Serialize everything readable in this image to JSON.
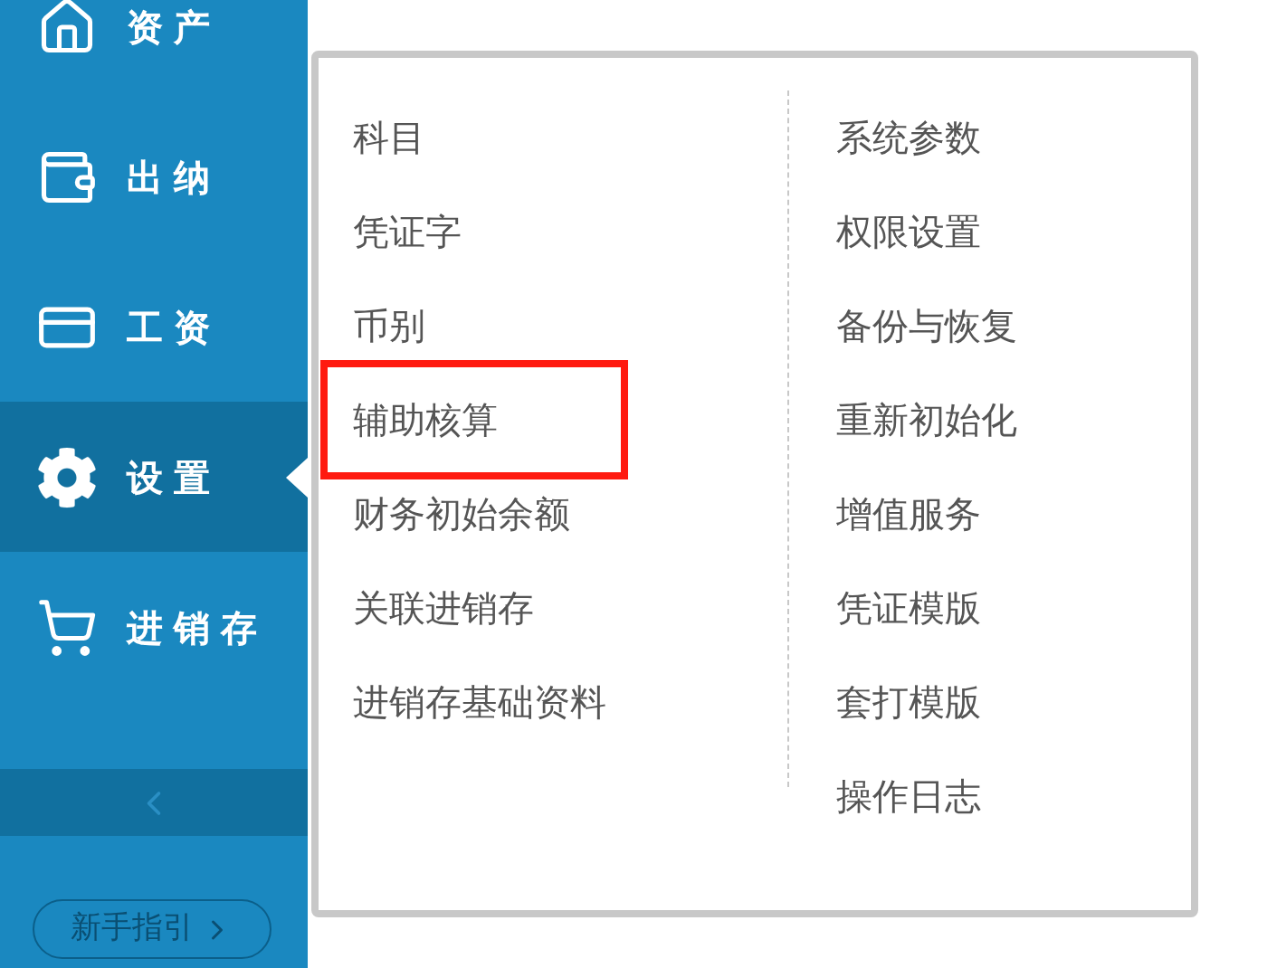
{
  "sidebar": {
    "items": [
      {
        "label": "资产",
        "selected": false
      },
      {
        "label": "出纳",
        "selected": false
      },
      {
        "label": "工资",
        "selected": false
      },
      {
        "label": "设置",
        "selected": true
      },
      {
        "label": "进销存",
        "selected": false
      }
    ],
    "guide_button": "新手指引"
  },
  "settings_menu": {
    "columns": [
      [
        {
          "label": "科目",
          "highlighted": false
        },
        {
          "label": "凭证字",
          "highlighted": false
        },
        {
          "label": "币别",
          "highlighted": false
        },
        {
          "label": "辅助核算",
          "highlighted": true
        },
        {
          "label": "财务初始余额",
          "highlighted": false
        },
        {
          "label": "关联进销存",
          "highlighted": false
        },
        {
          "label": "进销存基础资料",
          "highlighted": false
        }
      ],
      [
        {
          "label": "系统参数",
          "highlighted": false
        },
        {
          "label": "权限设置",
          "highlighted": false
        },
        {
          "label": "备份与恢复",
          "highlighted": false
        },
        {
          "label": "重新初始化",
          "highlighted": false
        },
        {
          "label": "增值服务",
          "highlighted": false
        },
        {
          "label": "凭证模版",
          "highlighted": false
        },
        {
          "label": "套打模版",
          "highlighted": false
        },
        {
          "label": "操作日志",
          "highlighted": false
        }
      ]
    ]
  }
}
